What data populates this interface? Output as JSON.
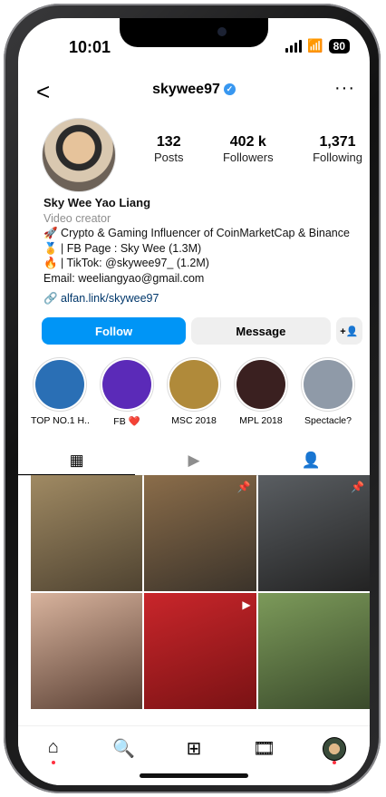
{
  "status_bar": {
    "time": "10:01",
    "battery": "80"
  },
  "header": {
    "username": "skywee97",
    "back_label": "<",
    "more_label": "···"
  },
  "stats": [
    {
      "value": "132",
      "label": "Posts"
    },
    {
      "value": "402 k",
      "label": "Followers"
    },
    {
      "value": "1,371",
      "label": "Following"
    }
  ],
  "bio": {
    "name": "Sky Wee Yao Liang",
    "category": "Video creator",
    "lines": [
      "🚀 Crypto & Gaming Influencer of CoinMarketCap & Binance",
      "🏅 | FB Page : Sky Wee (1.3M)",
      "🔥 | TikTok: @skywee97_ (1.2M)",
      "Email: weeliangyao@gmail.com"
    ],
    "link": "alfan.link/skywee97"
  },
  "actions": {
    "follow": "Follow",
    "message": "Message",
    "add_user": "+👤"
  },
  "highlights": [
    {
      "label": "TOP NO.1 H...",
      "color": "#2a6fb5"
    },
    {
      "label": "FB ❤️",
      "color": "#5b2ab8"
    },
    {
      "label": "MSC 2018",
      "color": "#b08a3a"
    },
    {
      "label": "MPL 2018",
      "color": "#3a2020"
    },
    {
      "label": "Spectacle?",
      "color": "#8f9aa8"
    }
  ],
  "tabs": [
    {
      "icon": "grid-icon",
      "glyph": "▦"
    },
    {
      "icon": "reels-icon",
      "glyph": "▶"
    },
    {
      "icon": "tagged-icon",
      "glyph": "👤"
    }
  ],
  "posts": [
    {
      "color": "#6b5a3e"
    },
    {
      "color": "#7a6a57"
    },
    {
      "color": "#3b3a38"
    },
    {
      "color": "#c7a08a"
    },
    {
      "color": "#b72025"
    },
    {
      "color": "#4f6b3d"
    }
  ],
  "nav": [
    {
      "icon": "home-icon",
      "glyph": "⌂"
    },
    {
      "icon": "search-icon",
      "glyph": "🔍"
    },
    {
      "icon": "create-icon",
      "glyph": "⊞"
    },
    {
      "icon": "reels-icon",
      "glyph": "🎞"
    },
    {
      "icon": "profile-icon",
      "glyph": ""
    }
  ]
}
